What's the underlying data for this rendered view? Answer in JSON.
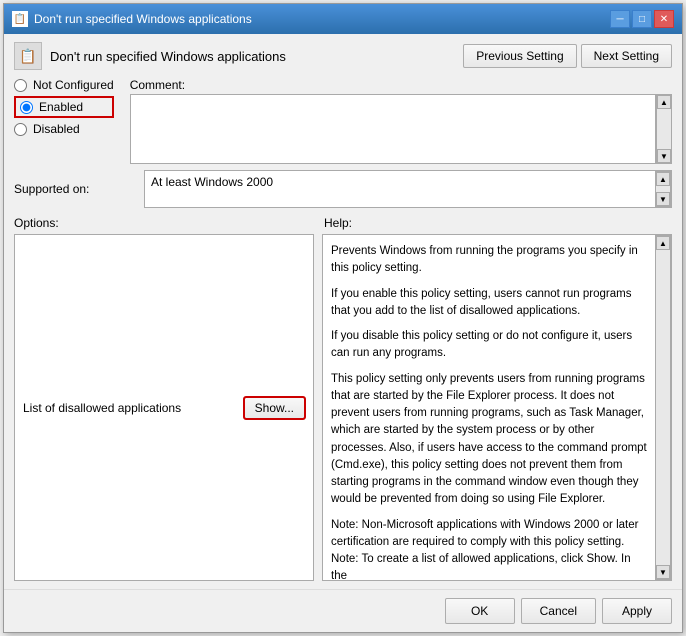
{
  "window": {
    "title": "Don't run specified Windows applications",
    "icon": "📋"
  },
  "header": {
    "title": "Don't run specified Windows applications",
    "prev_button": "Previous Setting",
    "next_button": "Next Setting"
  },
  "radio": {
    "not_configured_label": "Not Configured",
    "enabled_label": "Enabled",
    "disabled_label": "Disabled",
    "selected": "enabled"
  },
  "comment": {
    "label": "Comment:",
    "value": ""
  },
  "supported": {
    "label": "Supported on:",
    "value": "At least Windows 2000"
  },
  "sections": {
    "options_label": "Options:",
    "help_label": "Help:"
  },
  "options": {
    "list_label": "List of disallowed applications",
    "show_button": "Show..."
  },
  "help": {
    "paragraphs": [
      "Prevents Windows from running the programs you specify in this policy setting.",
      "If you enable this policy setting, users cannot run programs that you add to the list of disallowed applications.",
      "If you disable this policy setting or do not configure it, users can run any programs.",
      "This policy setting only prevents users from running programs that are started by the File Explorer process. It does not prevent users from running programs, such as Task Manager, which are started by the system process or by other processes.  Also, if users have access to the command prompt (Cmd.exe), this policy setting does not prevent them from starting programs in the command window even though they would be prevented from doing so using File Explorer.",
      "Note: Non-Microsoft applications with Windows 2000 or later certification are required to comply with this policy setting. Note: To create a list of allowed applications, click Show.  In the"
    ]
  },
  "footer": {
    "ok_label": "OK",
    "cancel_label": "Cancel",
    "apply_label": "Apply"
  },
  "titlebar": {
    "minimize": "─",
    "maximize": "□",
    "close": "✕"
  }
}
